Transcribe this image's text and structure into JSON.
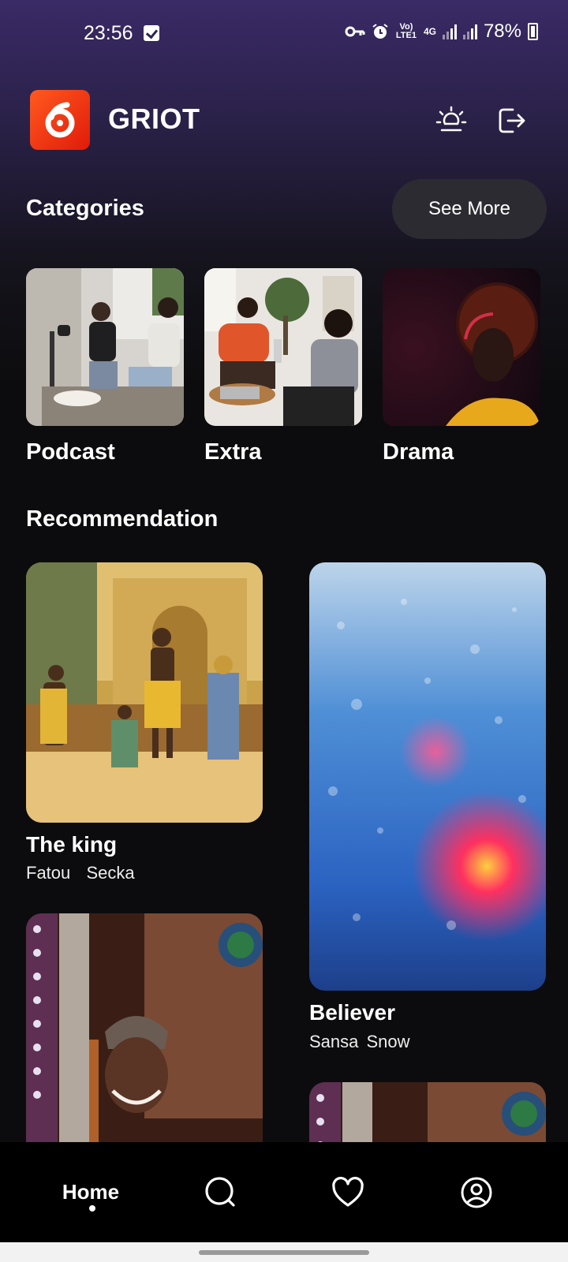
{
  "status_bar": {
    "time": "23:56",
    "network_top": "Vo) LTE1",
    "network_type": "4G",
    "battery": "78%"
  },
  "app": {
    "name": "GRIOT",
    "accent_color": "#ff4a17"
  },
  "categories": {
    "title": "Categories",
    "see_more_label": "See More",
    "items": [
      {
        "label": "Podcast"
      },
      {
        "label": "Extra"
      },
      {
        "label": "Drama"
      }
    ]
  },
  "recommendation": {
    "title": "Recommendation",
    "items": [
      {
        "title": "The king",
        "artist": "Fatou  Secka"
      },
      {
        "title": "Believer",
        "artist": "Sansa Snow"
      }
    ]
  },
  "bottom_nav": {
    "home_label": "Home",
    "active": "home",
    "icons": [
      "search-icon",
      "heart-icon",
      "profile-icon"
    ]
  }
}
